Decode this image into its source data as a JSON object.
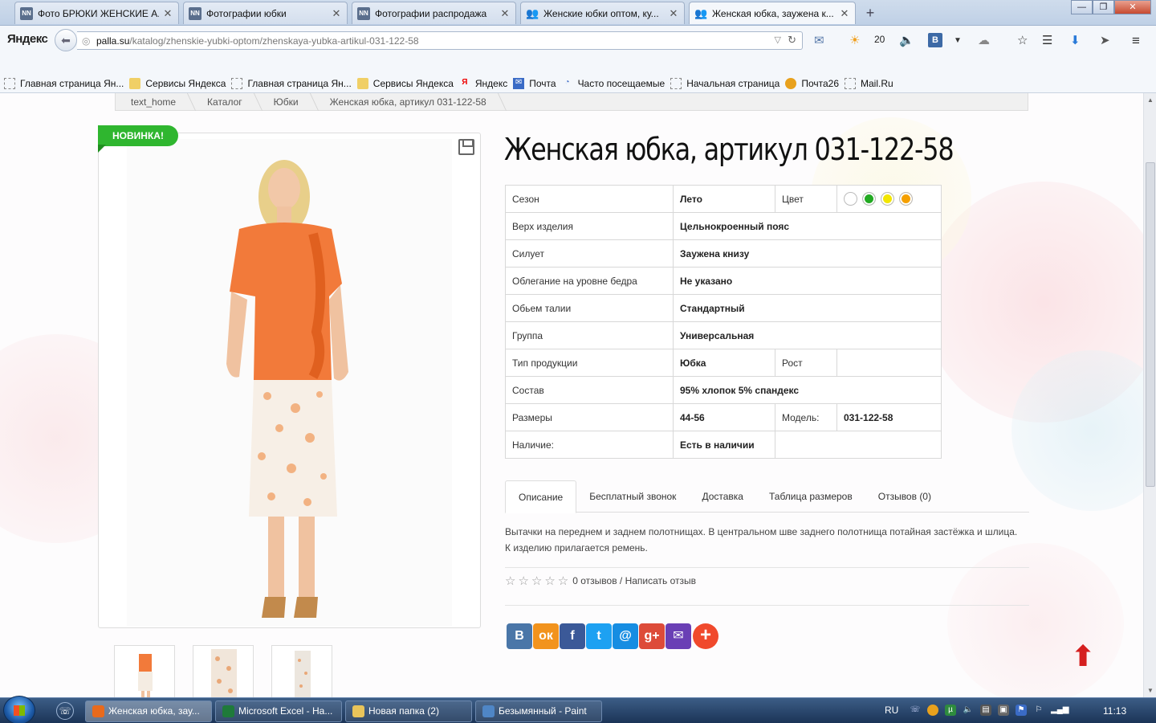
{
  "browser": {
    "tabs": [
      {
        "label": "Фото БРЮКИ ЖЕНСКИЕ А...",
        "favicon": "NN"
      },
      {
        "label": "Фотографии юбки",
        "favicon": "NN"
      },
      {
        "label": "Фотографии распродажа",
        "favicon": "NN"
      },
      {
        "label": "Женские юбки оптом, ку...",
        "favicon": "people-icon"
      },
      {
        "label": "Женская юбка, заужена к...",
        "favicon": "people-icon"
      }
    ],
    "active_tab": 4,
    "new_tab_symbol": "+",
    "logo": "Яндекс",
    "url_domain": "palla.su",
    "url_path": "/katalog/zhenskie-yubki-optom/zhenskaya-yubka-artikul-031-122-58",
    "weather_temp": "20",
    "vk_label": "В",
    "bookmarks": [
      {
        "label": "Главная страница Ян...",
        "icon": "blank"
      },
      {
        "label": "Сервисы Яндекса",
        "icon": "folder"
      },
      {
        "label": "Главная страница Ян...",
        "icon": "blank"
      },
      {
        "label": "Сервисы Яндекса",
        "icon": "folder"
      },
      {
        "label": "Яндекс",
        "icon": "yandex"
      },
      {
        "label": "Почта",
        "icon": "mail"
      },
      {
        "label": "Часто посещаемые",
        "icon": "none"
      },
      {
        "label": "Начальная страница",
        "icon": "blank"
      },
      {
        "label": "Почта26",
        "icon": "pochta26"
      },
      {
        "label": "Mail.Ru",
        "icon": "blank"
      }
    ]
  },
  "breadcrumb": [
    "text_home",
    "Каталог",
    "Юбки",
    "Женская юбка, артикул 031-122-58"
  ],
  "product": {
    "badge": "НОВИНКА!",
    "title": "Женская юбка, артикул 031-122-58",
    "specs": {
      "season_label": "Сезон",
      "season": "Лето",
      "color_label": "Цвет",
      "colors": [
        "#ffffff",
        "#22aa22",
        "#f2e600",
        "#f5a000"
      ],
      "top_label": "Верх изделия",
      "top": "Цельнокроенный пояс",
      "silhouette_label": "Силует",
      "silhouette": "Заужена книзу",
      "hip_label": "Облегание на уровне бедра",
      "hip": "Не указано",
      "waist_label": "Обьем талии",
      "waist": "Стандартный",
      "group_label": "Группа",
      "group": "Универсальная",
      "type_label": "Тип продукции",
      "type": "Юбка",
      "height_label": "Рост",
      "height": "",
      "composition_label": "Состав",
      "composition": "95% хлопок 5% спандекс",
      "sizes_label": "Размеры",
      "sizes": "44-56",
      "model_label": "Модель:",
      "model": "031-122-58",
      "availability_label": "Наличие:",
      "availability": "Есть в наличии"
    },
    "tabs": [
      "Описание",
      "Бесплатный звонок",
      "Доставка",
      "Таблица размеров",
      "Отзывов (0)"
    ],
    "description": "Вытачки на переднем и заднем полотнищах. В центральном шве заднего полотнища потайная застёжка и шлица. К изделию прилагается ремень.",
    "reviews_text": "0 отзывов / Написать отзыв",
    "stars": "☆☆☆☆☆",
    "share": [
      {
        "label": "В",
        "color": "#4a76a8",
        "name": "vk"
      },
      {
        "label": "ок",
        "color": "#f2931d",
        "name": "odnoklassniki"
      },
      {
        "label": "f",
        "color": "#3b5998",
        "name": "facebook"
      },
      {
        "label": "t",
        "color": "#1da1f2",
        "name": "twitter"
      },
      {
        "label": "@",
        "color": "#168de2",
        "name": "mailru"
      },
      {
        "label": "g+",
        "color": "#dd4b39",
        "name": "googleplus"
      },
      {
        "label": "✉",
        "color": "#6a3fb5",
        "name": "email"
      },
      {
        "label": "+",
        "color": "#f0492c",
        "name": "more"
      }
    ]
  },
  "taskbar": {
    "items": [
      {
        "label": "Женская юбка, зау...",
        "icon_color": "#e86a1c"
      },
      {
        "label": "Microsoft Excel - На...",
        "icon_color": "#1f7a3a"
      },
      {
        "label": "Новая папка (2)",
        "icon_color": "#e9c45a"
      },
      {
        "label": "Безымянный - Paint",
        "icon_color": "#4f86c6"
      }
    ],
    "lang": "RU",
    "time": "11:13"
  }
}
